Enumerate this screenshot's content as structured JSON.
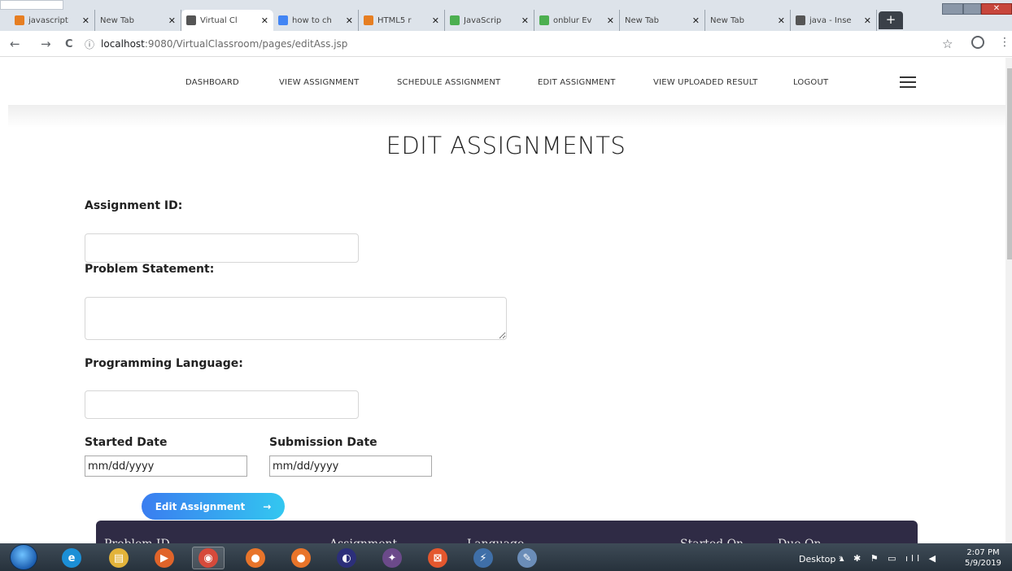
{
  "browser": {
    "tabs": [
      {
        "label": "javascript",
        "color": "#e67e22"
      },
      {
        "label": "New Tab",
        "color": ""
      },
      {
        "label": "Virtual Cl",
        "color": "#555555"
      },
      {
        "label": "how to ch",
        "color": "#4285f4"
      },
      {
        "label": "HTML5 r",
        "color": "#e67e22"
      },
      {
        "label": "JavaScrip",
        "color": "#4caf50"
      },
      {
        "label": "onblur Ev",
        "color": "#4caf50"
      },
      {
        "label": "New Tab",
        "color": ""
      },
      {
        "label": "New Tab",
        "color": ""
      },
      {
        "label": "java - Inse",
        "color": "#555555"
      }
    ],
    "tab_close_glyph": "✕",
    "new_tab_glyph": "+",
    "url_host": "localhost",
    "url_path": ":9080/VirtualClassroom/pages/editAss.jsp",
    "back_glyph": "←",
    "forward_glyph": "→",
    "reload_glyph": "C",
    "info_glyph": "ⓘ",
    "star_glyph": "☆",
    "menu_glyph": "⋮"
  },
  "nav": {
    "items": [
      "DASHBOARD",
      "VIEW ASSIGNMENT",
      "SCHEDULE ASSIGNMENT",
      "EDIT ASSIGNMENT",
      "VIEW UPLOADED RESULT",
      "LOGOUT"
    ]
  },
  "form": {
    "title": "EDIT ASSIGNMENTS",
    "assignment_id_label": "Assignment ID:",
    "assignment_id_value": "",
    "problem_statement_label": "Problem Statement:",
    "problem_statement_value": "",
    "language_label": "Programming Language:",
    "language_value": "",
    "start_date_label": "Started Date",
    "start_date_value": "mm/dd/yyyy",
    "submission_date_label": "Submission Date",
    "submission_date_value": "mm/dd/yyyy",
    "submit_label": "Edit Assignment",
    "submit_arrow": "→"
  },
  "table": {
    "headers": [
      "Problem ID",
      "Assignment",
      "Language",
      "Started On",
      "Due On"
    ]
  },
  "taskbar": {
    "apps": [
      {
        "icon": "ie-icon",
        "glyph": "e",
        "color": "#1c8fd6"
      },
      {
        "icon": "file-explorer-icon",
        "glyph": "▤",
        "color": "#e2b33a"
      },
      {
        "icon": "media-player-icon",
        "glyph": "▶",
        "color": "#e0642a"
      },
      {
        "icon": "chrome-icon",
        "glyph": "◉",
        "color": "#d64a3b"
      },
      {
        "icon": "firefox-icon",
        "glyph": "●",
        "color": "#e8742a"
      },
      {
        "icon": "firefox-icon",
        "glyph": "●",
        "color": "#e8742a"
      },
      {
        "icon": "eclipse-icon",
        "glyph": "◐",
        "color": "#2c2f7a"
      },
      {
        "icon": "tomcat-icon",
        "glyph": "✦",
        "color": "#6b4a8a"
      },
      {
        "icon": "xampp-icon",
        "glyph": "⊠",
        "color": "#e4572e"
      },
      {
        "icon": "filezilla-icon",
        "glyph": "⚡",
        "color": "#3f6fa8"
      },
      {
        "icon": "paint-icon",
        "glyph": "✎",
        "color": "#6b8db8"
      }
    ],
    "desktop_label": "Desktop",
    "desktop_chevron": "»",
    "tray_glyphs": "▴ ✱ ⚑ ▭ ıll ◀",
    "time": "2:07 PM",
    "date": "5/9/2019"
  }
}
